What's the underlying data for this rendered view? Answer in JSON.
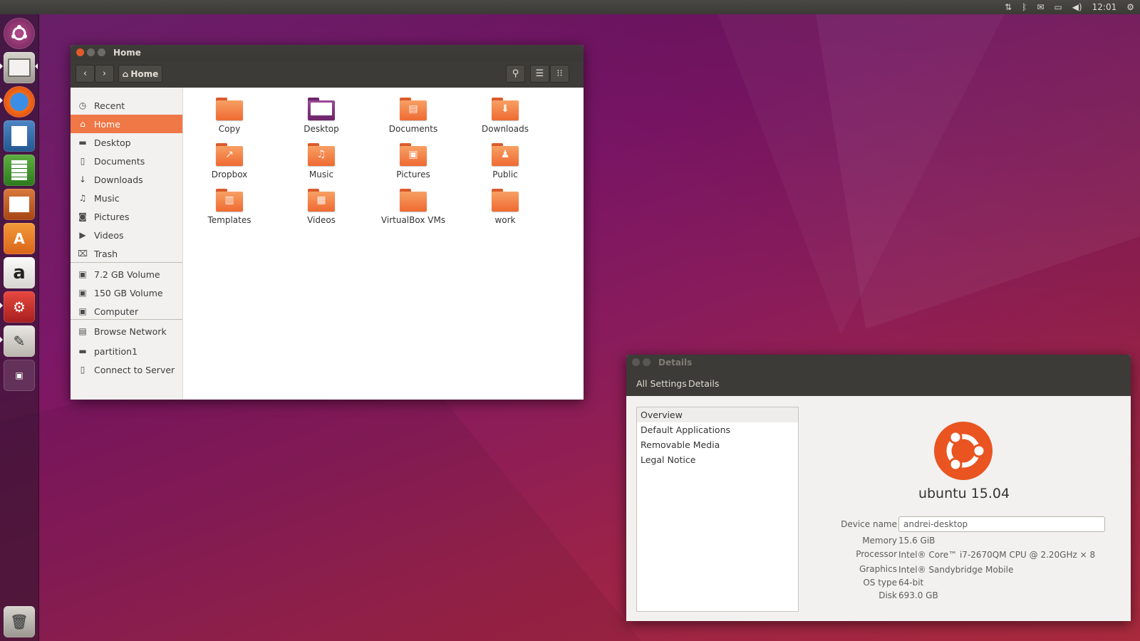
{
  "top_panel": {
    "clock": "12:01",
    "indicators": [
      "network-icon",
      "bluetooth-icon",
      "mail-icon",
      "battery-icon",
      "volume-icon",
      "gear-icon"
    ]
  },
  "launcher": {
    "items": [
      "ubuntu-dash-icon",
      "files-icon",
      "firefox-icon",
      "libreoffice-writer-icon",
      "libreoffice-calc-icon",
      "libreoffice-impress-icon",
      "software-center-icon",
      "amazon-icon",
      "system-settings-icon",
      "text-editor-icon",
      "workspace-switcher-icon",
      "trash-icon"
    ]
  },
  "files_window": {
    "title": "Home",
    "path_button": "Home",
    "sidebar": [
      {
        "label": "Recent",
        "icon": "clock-icon",
        "glyph": "◷"
      },
      {
        "label": "Home",
        "icon": "home-icon",
        "glyph": "⌂",
        "active": true
      },
      {
        "label": "Desktop",
        "icon": "folder-icon",
        "glyph": "▬"
      },
      {
        "label": "Documents",
        "icon": "document-icon",
        "glyph": "▯"
      },
      {
        "label": "Downloads",
        "icon": "download-icon",
        "glyph": "↓"
      },
      {
        "label": "Music",
        "icon": "music-icon",
        "glyph": "♫"
      },
      {
        "label": "Pictures",
        "icon": "camera-icon",
        "glyph": "◙"
      },
      {
        "label": "Videos",
        "icon": "video-icon",
        "glyph": "▶"
      },
      {
        "label": "Trash",
        "icon": "trash-icon",
        "glyph": "⌧"
      },
      {
        "label": "7.2 GB Volume",
        "icon": "drive-icon",
        "glyph": "▣"
      },
      {
        "label": "150 GB Volume",
        "icon": "drive-icon",
        "glyph": "▣"
      },
      {
        "label": "Computer",
        "icon": "drive-icon",
        "glyph": "▣"
      },
      {
        "label": "Browse Network",
        "icon": "network-icon",
        "glyph": "▤"
      },
      {
        "label": "partition1",
        "icon": "folder-icon",
        "glyph": "▬"
      },
      {
        "label": "Connect to Server",
        "icon": "server-icon",
        "glyph": "▯"
      }
    ],
    "files": [
      {
        "label": "Copy",
        "emblem": ""
      },
      {
        "label": "Desktop",
        "emblem": "",
        "style": "purple"
      },
      {
        "label": "Documents",
        "emblem": "▤"
      },
      {
        "label": "Downloads",
        "emblem": "⬇"
      },
      {
        "label": "Dropbox",
        "emblem": "↗"
      },
      {
        "label": "Music",
        "emblem": "♫"
      },
      {
        "label": "Pictures",
        "emblem": "▣"
      },
      {
        "label": "Public",
        "emblem": "♟"
      },
      {
        "label": "Templates",
        "emblem": "▥"
      },
      {
        "label": "Videos",
        "emblem": "▦"
      },
      {
        "label": "VirtualBox VMs",
        "emblem": ""
      },
      {
        "label": "work",
        "emblem": ""
      }
    ]
  },
  "details_window": {
    "title": "Details",
    "breadcrumbs": [
      "All Settings",
      "Details"
    ],
    "sections": [
      "Overview",
      "Default Applications",
      "Removable Media",
      "Legal Notice"
    ],
    "distro": "ubuntu 15.04",
    "fields": {
      "device_name_label": "Device name",
      "device_name": "andrei-desktop",
      "memory_label": "Memory",
      "memory": "15.6 GiB",
      "processor_label": "Processor",
      "processor": "Intel® Core™ i7-2670QM CPU @ 2.20GHz × 8",
      "graphics_label": "Graphics",
      "graphics": "Intel® Sandybridge Mobile",
      "os_type_label": "OS type",
      "os_type": "64-bit",
      "disk_label": "Disk",
      "disk": "693.0 GB"
    }
  },
  "colors": {
    "accent": "#f07746",
    "ubuntu_orange": "#e95420",
    "panel": "#3c3b37"
  }
}
